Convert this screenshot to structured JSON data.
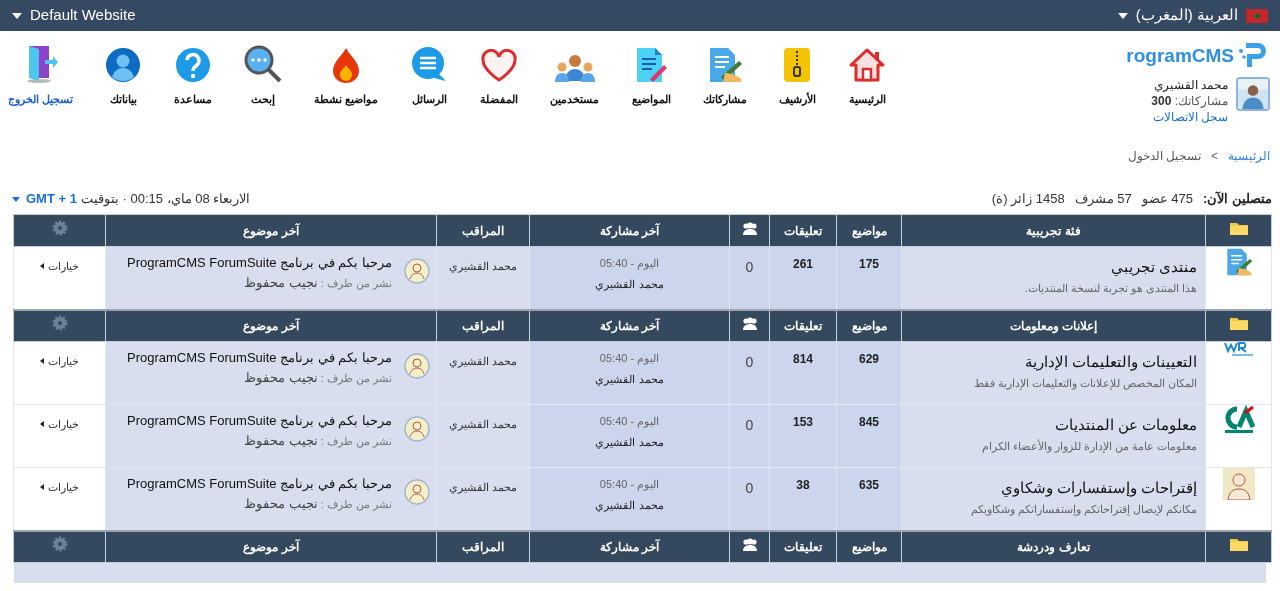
{
  "top_bar": {
    "site": "Default Website",
    "language": "العربية (المغرب)"
  },
  "user": {
    "logo": "rogramCMS",
    "name": "محمد القشيري",
    "posts_label": "مشاركاتك:",
    "posts": "300",
    "link": "سجل الاتصالات"
  },
  "nav": [
    {
      "label": "الرئيسية",
      "kind": "item"
    },
    {
      "label": "الأرشيف",
      "kind": "item"
    },
    {
      "label": "مشاركاتك",
      "kind": "item"
    },
    {
      "label": "المواضيع",
      "kind": "item"
    },
    {
      "label": "مستخدمين",
      "kind": "item"
    },
    {
      "label": "المفضلة",
      "kind": "item"
    },
    {
      "label": "الرسائل",
      "kind": "item"
    },
    {
      "label": "مواضيع نشطة",
      "kind": "item"
    },
    {
      "label": "إبحث",
      "kind": "item"
    },
    {
      "label": "مساعدة",
      "kind": "item"
    },
    {
      "label": "بياناتك",
      "kind": "item"
    },
    {
      "label": "تسجيل الخروج",
      "kind": "link"
    }
  ],
  "breadcrumb": [
    {
      "label": "الرئيسية",
      "kind": "link"
    },
    {
      "label": "تسجيل الدخول",
      "kind": "current"
    }
  ],
  "breadcrumb_separator": ">",
  "online": {
    "label": "متصلين الآن:",
    "counts": [
      "475 عضو",
      "57 مشرف",
      "1458 زائر (ة)"
    ]
  },
  "time": {
    "text": "الاربعاء 08 ماي، 00:15 · بتوقيت",
    "zone": "GMT + 1"
  },
  "categories": [
    {
      "title": "فئة تجريبية",
      "columns": [
        "مواضيع",
        "تعليقات",
        "آخر مشاركة",
        "المراقب",
        "آخر موضوع"
      ],
      "forums": [
        {
          "title": "منتدى تجريبي",
          "description": "هذا المنتدى هو تجربة لنسخة المنتديات.",
          "topics": "175",
          "comments": "261",
          "users": "0",
          "last_time": "اليوم - 05:40",
          "last_user": "محمد القشيري",
          "moderator": "محمد القشيري",
          "last_topic": "مرحبا بكم في برنامج ProgramCMS ForumSuite",
          "by_label": "نشر من طرف :",
          "author": "نجيب محفوظ",
          "options": "خيارات"
        }
      ]
    },
    {
      "title": "إعلانات ومعلومات",
      "columns": [
        "مواضيع",
        "تعليقات",
        "آخر مشاركة",
        "المراقب",
        "آخر موضوع"
      ],
      "forums": [
        {
          "title": "التعيينات والتعليمات الإدارية",
          "description": "المكان المخصص للإعلانات والتعليمات الإدارية فقط",
          "topics": "629",
          "comments": "814",
          "users": "0",
          "last_time": "اليوم - 05:40",
          "last_user": "محمد القشيري",
          "moderator": "محمد القشيري",
          "last_topic": "مرحبا بكم في برنامج ProgramCMS ForumSuite",
          "by_label": "نشر من طرف :",
          "author": "نجيب محفوظ",
          "options": "خيارات"
        },
        {
          "title": "معلومات عن المنتديات",
          "description": "معلومات عامة من الإدارة للزوار والأعضاء الكرام",
          "topics": "845",
          "comments": "153",
          "users": "0",
          "last_time": "اليوم - 05:40",
          "last_user": "محمد القشيري",
          "moderator": "محمد القشيري",
          "last_topic": "مرحبا بكم في برنامج ProgramCMS ForumSuite",
          "by_label": "نشر من طرف :",
          "author": "نجيب محفوظ",
          "options": "خيارات"
        },
        {
          "title": "إقتراحات وإستفسارات وشكاوي",
          "description": "مكانكم لإيصال إقتراحاتكم وإستفساراتكم وشكاويكم",
          "topics": "635",
          "comments": "38",
          "users": "0",
          "last_time": "اليوم - 05:40",
          "last_user": "محمد القشيري",
          "moderator": "محمد القشيري",
          "last_topic": "مرحبا بكم في برنامج ProgramCMS ForumSuite",
          "by_label": "نشر من طرف :",
          "author": "نجيب محفوظ",
          "options": "خيارات"
        }
      ]
    },
    {
      "title": "تعارف ودردشة",
      "columns": [
        "مواضيع",
        "تعليقات",
        "آخر مشاركة",
        "المراقب",
        "آخر موضوع"
      ]
    }
  ]
}
